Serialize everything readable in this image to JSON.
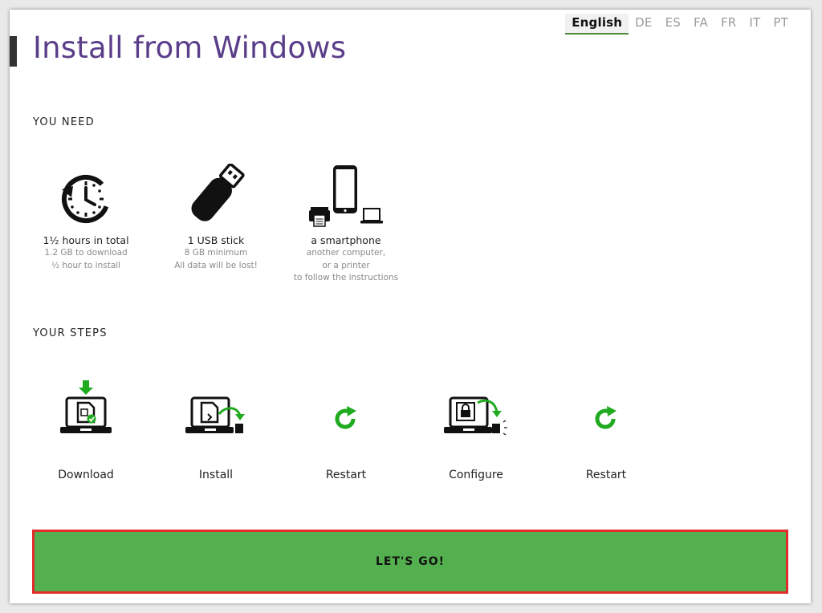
{
  "languages": {
    "active": "English",
    "others": [
      "DE",
      "ES",
      "FA",
      "FR",
      "IT",
      "PT"
    ]
  },
  "page": {
    "title": "Install from Windows"
  },
  "you_need": {
    "heading": "YOU NEED",
    "items": [
      {
        "title": "1½ hours in total",
        "lines": [
          "1.2 GB to download",
          "½ hour to install"
        ]
      },
      {
        "title": "1 USB stick",
        "lines": [
          "8 GB minimum",
          "All data will be lost!"
        ]
      },
      {
        "title": "a smartphone",
        "lines": [
          "another computer,",
          "or a printer",
          "to follow the instructions"
        ]
      }
    ]
  },
  "your_steps": {
    "heading": "YOUR STEPS",
    "items": [
      {
        "label": "Download"
      },
      {
        "label": "Install"
      },
      {
        "label": "Restart"
      },
      {
        "label": "Configure"
      },
      {
        "label": "Restart"
      }
    ]
  },
  "cta": {
    "label": "LET'S GO!"
  },
  "colors": {
    "title": "#5b3e8a",
    "accent_green": "#1faa1f",
    "button_green": "#54b04f",
    "button_border": "#e22b2b"
  },
  "icons": {
    "time": "clock-rewind-icon",
    "usb": "usb-stick-icon",
    "devices": "smartphone-printer-laptop-icon",
    "download": "laptop-download-icon",
    "install": "laptop-install-icon",
    "restart": "restart-icon",
    "configure": "laptop-lock-icon"
  }
}
